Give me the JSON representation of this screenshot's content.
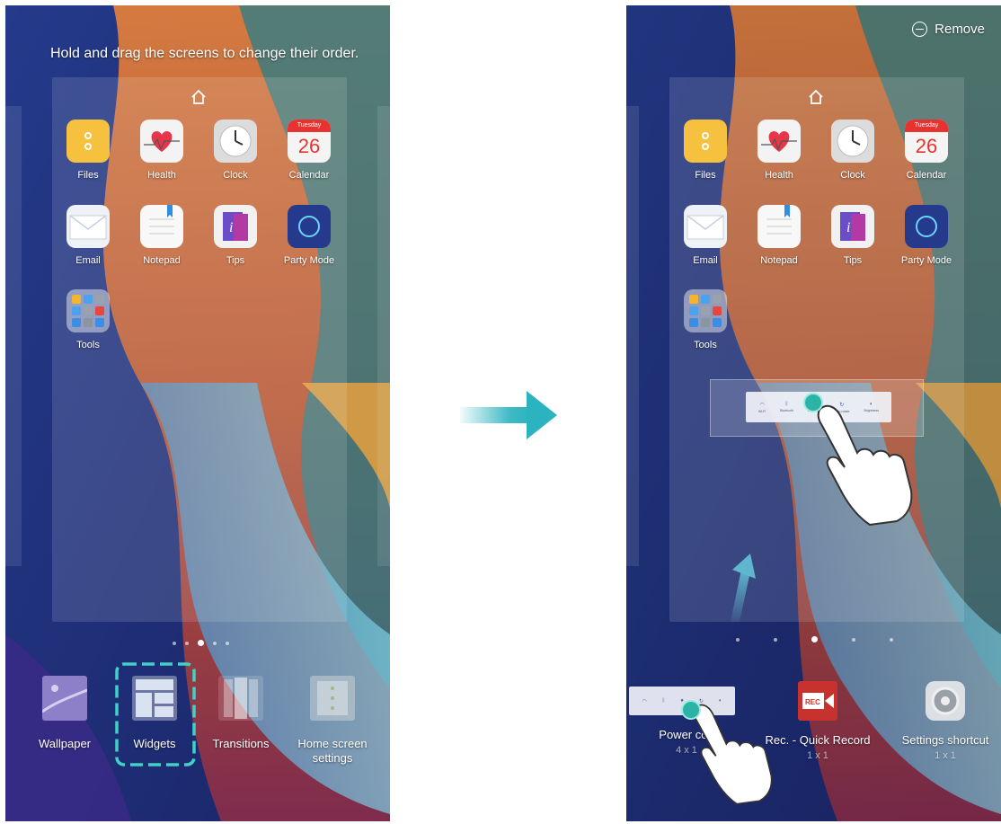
{
  "left_screen": {
    "hint": "Hold and drag the screens to change their order.",
    "apps_row1": [
      {
        "label": "Files",
        "icon": "files-icon"
      },
      {
        "label": "Health",
        "icon": "health-icon"
      },
      {
        "label": "Clock",
        "icon": "clock-icon"
      },
      {
        "label": "Calendar",
        "icon": "calendar-icon"
      }
    ],
    "apps_row2": [
      {
        "label": "Email",
        "icon": "email-icon"
      },
      {
        "label": "Notepad",
        "icon": "notepad-icon"
      },
      {
        "label": "Tips",
        "icon": "tips-icon"
      },
      {
        "label": "Party Mode",
        "icon": "party-mode-icon"
      }
    ],
    "folder": {
      "label": "Tools",
      "icon": "tools-folder-icon"
    },
    "calendar": {
      "weekday": "Tuesday",
      "day": "26"
    },
    "page_indicator": {
      "count": 5,
      "active_index": 2
    },
    "options": [
      {
        "label": "Wallpaper",
        "icon": "wallpaper-icon"
      },
      {
        "label": "Widgets",
        "icon": "widgets-icon",
        "highlighted": true
      },
      {
        "label": "Transitions",
        "icon": "transitions-icon"
      },
      {
        "label": "Home screen settings",
        "icon": "home-screen-settings-icon"
      }
    ]
  },
  "right_screen": {
    "remove_label": "Remove",
    "calendar": {
      "weekday": "Tuesday",
      "day": "26"
    },
    "apps_row1": [
      {
        "label": "Files"
      },
      {
        "label": "Health"
      },
      {
        "label": "Clock"
      },
      {
        "label": "Calendar"
      }
    ],
    "apps_row2": [
      {
        "label": "Email"
      },
      {
        "label": "Notepad"
      },
      {
        "label": "Tips"
      },
      {
        "label": "Party Mode"
      }
    ],
    "folder": {
      "label": "Tools"
    },
    "page_indicator": {
      "count": 5,
      "active_index": 2
    },
    "widgets": [
      {
        "name": "Power con",
        "size": "4 x 1",
        "icon": "power-control-widget-icon"
      },
      {
        "name": "Rec. - Quick Record",
        "size": "1 x 1",
        "icon": "quick-record-icon"
      },
      {
        "name": "Settings shortcut",
        "size": "1 x 1",
        "icon": "settings-shortcut-icon"
      }
    ],
    "widget_strip_labels": [
      "Wi-Fi",
      "Bluetooth",
      "Location",
      "Auto-rotate",
      "Brightness"
    ]
  },
  "colors": {
    "arrow": "#2bb3c0",
    "highlight_border": "#3fd1c9",
    "wallpaper_blue": "#1c2a6e",
    "wallpaper_orange": "#e4732c"
  }
}
